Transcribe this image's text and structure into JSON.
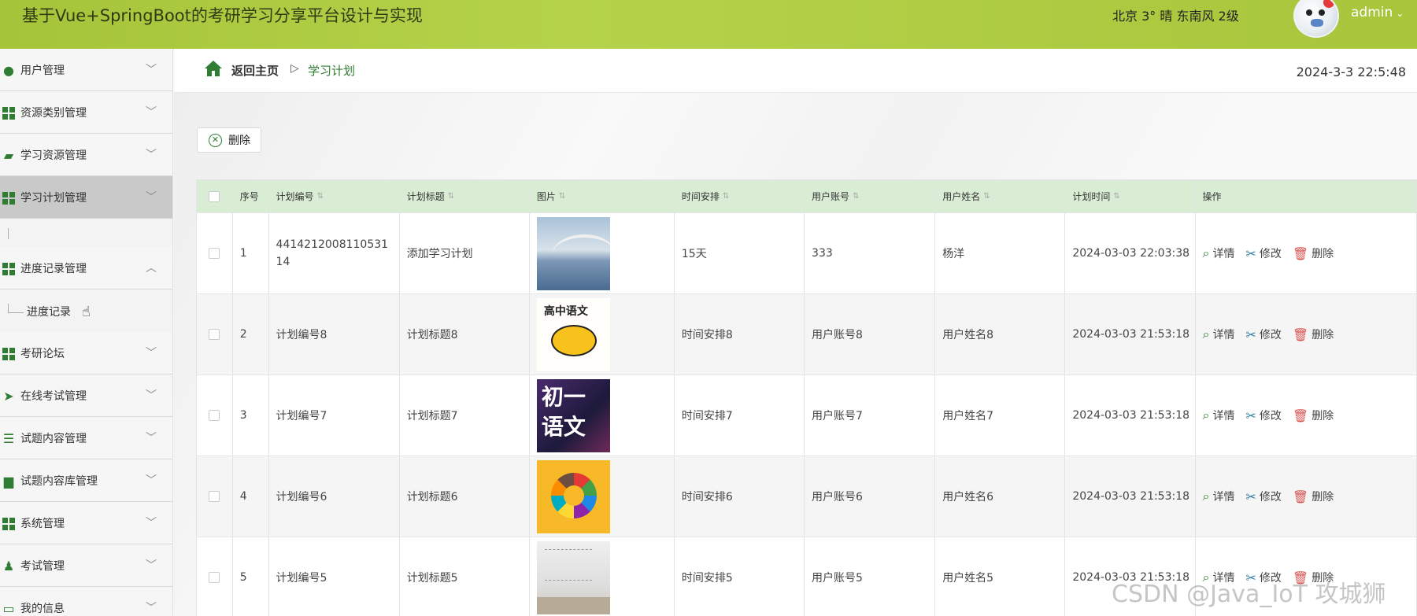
{
  "header": {
    "title": "基于Vue+SpringBoot的考研学习分享平台设计与实现",
    "weather": "北京  3°  晴  东南风  2级",
    "username": "admin"
  },
  "sidebar": {
    "items": [
      {
        "label": "用户管理",
        "icon": "lightbulb-icon"
      },
      {
        "label": "资源类别管理",
        "icon": "grid-icon"
      },
      {
        "label": "学习资源管理",
        "icon": "folder-icon"
      },
      {
        "label": "学习计划管理",
        "icon": "grid-icon"
      },
      {
        "label": "进度记录管理",
        "icon": "grid-icon"
      },
      {
        "label": "考研论坛",
        "icon": "grid-icon"
      },
      {
        "label": "在线考试管理",
        "icon": "paper-plane-icon"
      },
      {
        "label": "试题内容管理",
        "icon": "sliders-icon"
      },
      {
        "label": "试题内容库管理",
        "icon": "monitor-icon"
      },
      {
        "label": "系统管理",
        "icon": "grid-icon"
      },
      {
        "label": "考试管理",
        "icon": "stamp-icon"
      },
      {
        "label": "我的信息",
        "icon": "card-icon"
      }
    ],
    "subitem": "进度记录"
  },
  "breadcrumb": {
    "home": "返回主页",
    "separator": "▷",
    "current": "学习计划",
    "datetime": "2024-3-3 22:5:48"
  },
  "toolbar": {
    "delete_label": "删除"
  },
  "table": {
    "headers": [
      "序号",
      "计划编号",
      "计划标题",
      "图片",
      "时间安排",
      "用户账号",
      "用户姓名",
      "计划时间",
      "操作"
    ],
    "rows": [
      {
        "seq": "1",
        "code": "441421200811053114",
        "title": "添加学习计划",
        "sched": "15天",
        "acct": "333",
        "name": "杨洋",
        "time": "2024-03-03 22:03:38"
      },
      {
        "seq": "2",
        "code": "计划编号8",
        "title": "计划标题8",
        "sched": "时间安排8",
        "acct": "用户账号8",
        "name": "用户姓名8",
        "time": "2024-03-03 21:53:18"
      },
      {
        "seq": "3",
        "code": "计划编号7",
        "title": "计划标题7",
        "sched": "时间安排7",
        "acct": "用户账号7",
        "name": "用户姓名7",
        "time": "2024-03-03 21:53:18"
      },
      {
        "seq": "4",
        "code": "计划编号6",
        "title": "计划标题6",
        "sched": "时间安排6",
        "acct": "用户账号6",
        "name": "用户姓名6",
        "time": "2024-03-03 21:53:18"
      },
      {
        "seq": "5",
        "code": "计划编号5",
        "title": "计划标题5",
        "sched": "时间安排5",
        "acct": "用户账号5",
        "name": "用户姓名5",
        "time": "2024-03-03 21:53:18"
      }
    ],
    "thumb_texts": {
      "t2": "高中语文",
      "t3_line1": "初一",
      "t3_line2": "语文"
    },
    "ops": {
      "detail": "详情",
      "edit": "修改",
      "delete": "删除"
    }
  },
  "watermark": "CSDN @Java_IoT 攻城狮",
  "colors": {
    "header_green": "#a6c43a",
    "accent_green": "#2e7d32",
    "table_head": "#d9ecd4",
    "delete_red": "#d9534f"
  }
}
